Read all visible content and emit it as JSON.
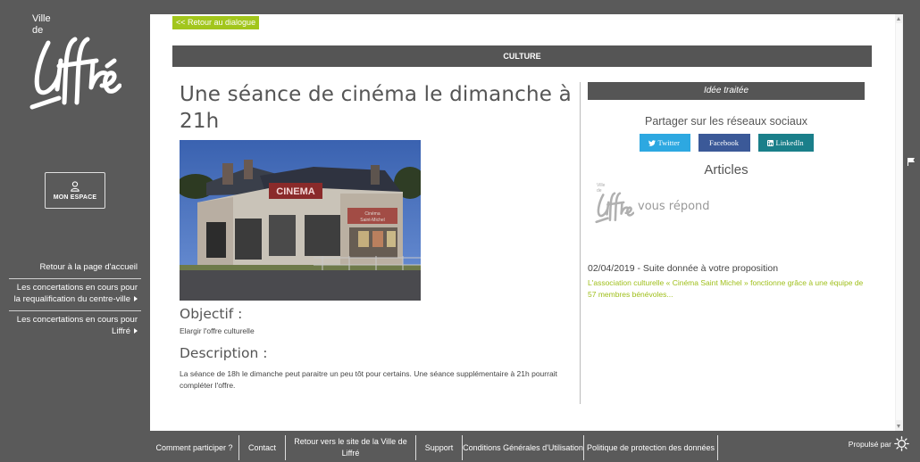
{
  "sidebar": {
    "logo": {
      "ville": "Ville",
      "de": "de",
      "name": "Liffré"
    },
    "mon_espace": "MON ESPACE",
    "nav": [
      {
        "label": "Retour à la page d'accueil",
        "arrow": false
      },
      {
        "label": "Les concertations en cours pour la requalification du centre-ville",
        "arrow": true
      },
      {
        "label": "Les concertations en cours pour Liffré",
        "arrow": true
      }
    ]
  },
  "main": {
    "back_label": "<< Retour au dialogue",
    "category": "CULTURE",
    "title": "Une séance de cinéma le dimanche à 21h",
    "photo": {
      "sign_top": "CINEMA",
      "sign_1": "Cinéma",
      "sign_2": "Saint-Michel"
    },
    "objectif_heading": "Objectif :",
    "objectif_text": "Elargir l'offre culturelle",
    "description_heading": "Description :",
    "description_text": "La séance de 18h le dimanche peut paraitre un peu tôt pour certains. Une séance supplémentaire à 21h pourrait compléter l'offre."
  },
  "right": {
    "status": "Idée traitée",
    "share_title": "Partager sur les réseaux sociaux",
    "share": {
      "twitter": "Twitter",
      "facebook": "Facebook",
      "linkedin": "LinkedIn"
    },
    "articles_title": "Articles",
    "repond_logo": {
      "ville": "Ville",
      "de": "de",
      "name": "Liffré"
    },
    "repond_text": "vous répond",
    "article_date": "02/04/2019 - Suite donnée à votre proposition",
    "article_excerpt": "L'association culturelle « Cinéma Saint Michel » fonctionne grâce à une équipe de 57 membres bénévoles..."
  },
  "footer": {
    "items": [
      "Comment participer ?",
      "Contact",
      "Retour vers le site de la Ville de Liffré",
      "Support",
      "Conditions Générales d'Utilisation",
      "Politique de protection des données"
    ],
    "powered": "Propulsé par"
  },
  "colors": {
    "accent": "#a2c61c",
    "dark_bar": "#555555",
    "sidebar_bg": "#5a5a5a",
    "twitter": "#2da8e1",
    "facebook": "#3b5998",
    "linkedin": "#1a7f8a"
  }
}
